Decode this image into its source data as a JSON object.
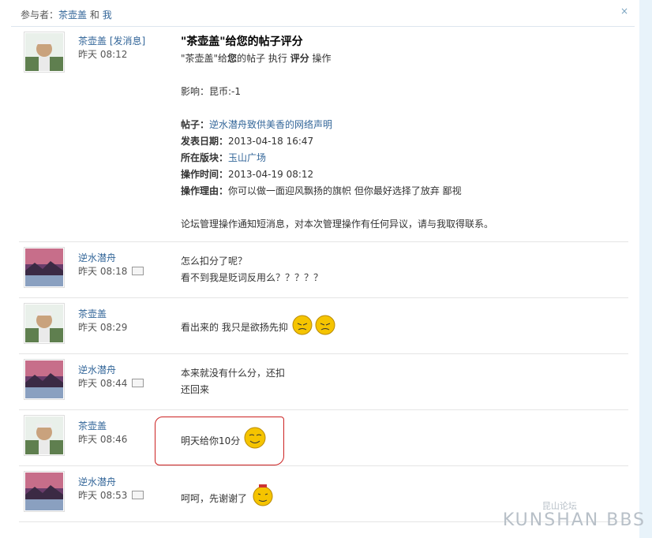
{
  "header": {
    "label": "参与者：",
    "user1": "茶壶盖",
    "and": "和",
    "user2": "我",
    "close": "×"
  },
  "messages": [
    {
      "author": "茶壶盖 [发消息]",
      "time": "昨天 08:12",
      "mail": false,
      "kind": "system",
      "title": "\"茶壶盖\"给您的帖子评分",
      "line1_a": "\"茶壶盖\"给",
      "line1_b": "您",
      "line1_c": "的帖子 执行 ",
      "line1_d": "评分",
      "line1_e": " 操作",
      "impact": "影响：昆币:-1",
      "post_label": "帖子：",
      "post_value": "逆水潜舟致供美香的网络声明",
      "date_label": "发表日期：",
      "date_value": "2013-04-18 16:47",
      "board_label": "所在版块：",
      "board_value": "玉山广场",
      "optime_label": "操作时间：",
      "optime_value": "2013-04-19 08:12",
      "reason_label": "操作理由：",
      "reason_value": "你可以做一面迎风飘扬的旗帜  但你最好选择了放弃  鄙视",
      "notice": "论坛管理操作通知短消息，对本次管理操作有任何异议，请与我取得联系。"
    },
    {
      "author": "逆水潜舟",
      "time": "昨天 08:18",
      "mail": true,
      "line1": "怎么扣分了呢？",
      "line2": "看不到我是贬词反用么？？？？？"
    },
    {
      "author": "茶壶盖",
      "time": "昨天 08:29",
      "mail": false,
      "line1": "看出来的  我只是欲扬先抑"
    },
    {
      "author": "逆水潜舟",
      "time": "昨天 08:44",
      "mail": true,
      "line1": "本来就没有什么分，还扣",
      "line2": "还回来"
    },
    {
      "author": "茶壶盖",
      "time": "昨天 08:46",
      "mail": false,
      "line1": "明天给你10分"
    },
    {
      "author": "逆水潜舟",
      "time": "昨天 08:53",
      "mail": true,
      "line1": "呵呵，先谢谢了"
    }
  ],
  "watermark": {
    "top": "昆山论坛",
    "main": "KUNSHAN BBS"
  }
}
